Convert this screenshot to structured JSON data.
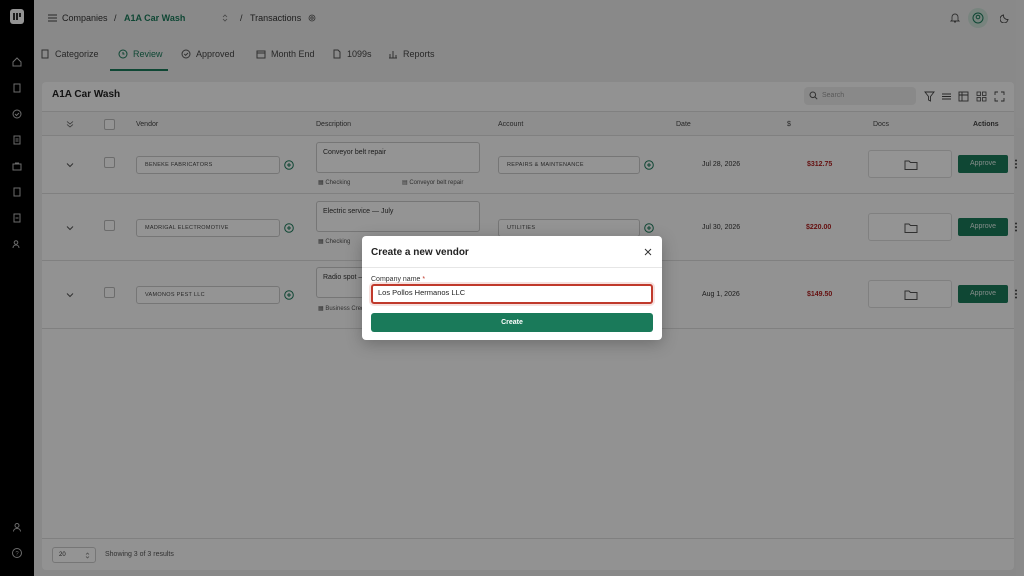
{
  "breadcrumb": {
    "root": "Companies",
    "company": "A1A Car Wash",
    "page": "Transactions"
  },
  "tabs": [
    {
      "label": "Categorize",
      "icon": "receipt-icon"
    },
    {
      "label": "Review",
      "icon": "clock-icon"
    },
    {
      "label": "Approved",
      "icon": "check-circle-icon"
    },
    {
      "label": "Month End",
      "icon": "calendar-icon"
    },
    {
      "label": "1099s",
      "icon": "document-icon"
    },
    {
      "label": "Reports",
      "icon": "bar-chart-icon"
    }
  ],
  "card": {
    "title": "A1A Car Wash",
    "search_placeholder": "Search"
  },
  "columns": [
    "Vendor",
    "Description",
    "Account",
    "Date",
    "$",
    "Docs",
    "Actions"
  ],
  "rows": [
    {
      "vendor": "BENEKE FABRICATORS",
      "description": "Conveyor belt repair",
      "source": "Checking",
      "memo": "Conveyor belt repair",
      "account": "REPAIRS & MAINTENANCE",
      "date": "Jul 28, 2026",
      "amount": "$312.75",
      "action": "Approve"
    },
    {
      "vendor": "MADRIGAL ELECTROMOTIVE",
      "description": "Electric service — July",
      "source": "Checking",
      "memo": "",
      "account": "UTILITIES",
      "date": "Jul 30, 2026",
      "amount": "$220.00",
      "action": "Approve"
    },
    {
      "vendor": "VAMONOS PEST LLC",
      "description": "Radio spot —",
      "source": "Business Credi",
      "memo": "",
      "account": "",
      "date": "Aug 1, 2026",
      "amount": "$149.50",
      "action": "Approve"
    }
  ],
  "footer": {
    "page_size": "20",
    "results": "Showing 3 of 3 results"
  },
  "modal": {
    "title": "Create a new vendor",
    "field_label": "Company name",
    "required_mark": "*",
    "field_value": "Los Pollos Hermanos LLC",
    "submit_label": "Create"
  },
  "colors": {
    "accent": "#1a7a5a",
    "amount": "#b02020",
    "error": "#c0392b"
  }
}
